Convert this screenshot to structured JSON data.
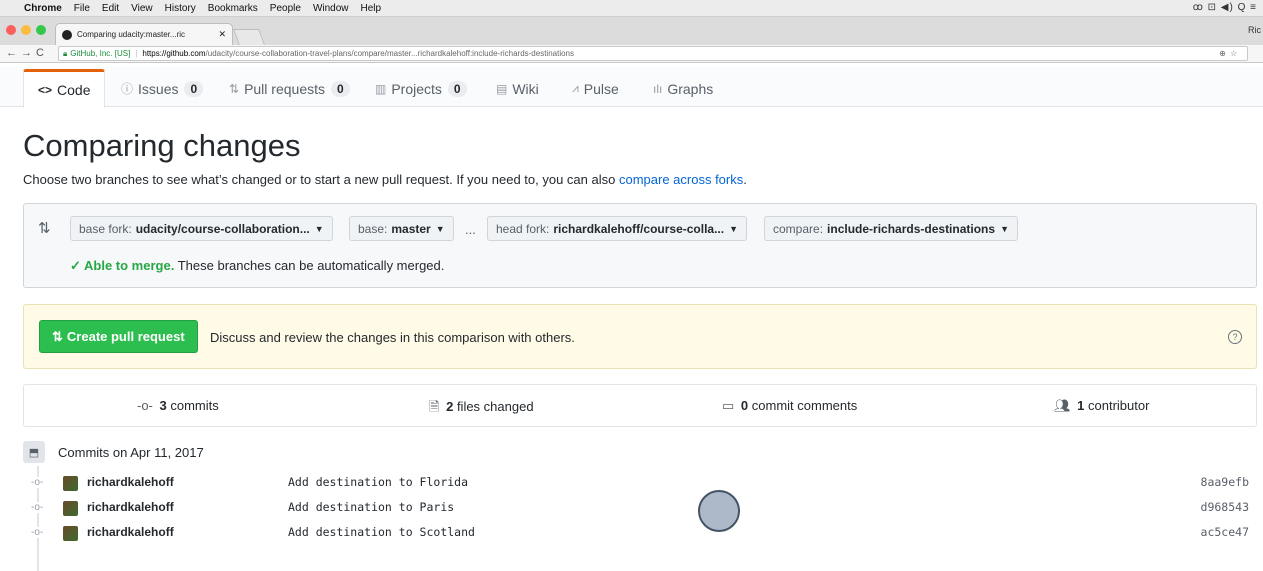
{
  "macbar": {
    "app": "Chrome",
    "menus": [
      "File",
      "Edit",
      "View",
      "History",
      "Bookmarks",
      "People",
      "Window",
      "Help"
    ],
    "status": "ꝏ ⊡ ◀) Q ≡"
  },
  "browser": {
    "tab_title": "Comparing udacity:master...ric",
    "profile": "Ric",
    "security_label": "GitHub, Inc. [US]",
    "url_host": "https://github.com",
    "url_path": "/udacity/course-collaboration-travel-plans/compare/master...richardkalehoff:include-richards-destinations"
  },
  "repo_tabs": [
    {
      "label": "Code",
      "icon": "<>",
      "count": ""
    },
    {
      "label": "Issues",
      "icon": "ⓘ",
      "count": "0"
    },
    {
      "label": "Pull requests",
      "icon": "⇅",
      "count": "0"
    },
    {
      "label": "Projects",
      "icon": "▥",
      "count": "0"
    },
    {
      "label": "Wiki",
      "icon": "▤",
      "count": ""
    },
    {
      "label": "Pulse",
      "icon": "⩘",
      "count": ""
    },
    {
      "label": "Graphs",
      "icon": "ılı",
      "count": ""
    }
  ],
  "page": {
    "title": "Comparing changes",
    "subtitle": "Choose two branches to see what’s changed or to start a new pull request. If you need to, you can also",
    "subtitle_link": "compare across forks",
    "subtitle_end": "."
  },
  "range": {
    "base_fork_label": "base fork:",
    "base_fork_value": "udacity/course-collaboration...",
    "base_label": "base:",
    "base_value": "master",
    "ellipsis": "...",
    "head_fork_label": "head fork:",
    "head_fork_value": "richardkalehoff/course-colla...",
    "compare_label": "compare:",
    "compare_value": "include-richards-destinations",
    "merge_status": "✓ Able to merge.",
    "merge_text": "These branches can be automatically merged."
  },
  "flash": {
    "button_label": "Create pull request",
    "text": "Discuss and review the changes in this comparison with others."
  },
  "summary": {
    "commits_count": "3",
    "commits_label": "commits",
    "files_count": "2",
    "files_label": "files changed",
    "comments_count": "0",
    "comments_label": "commit comments",
    "contributors_count": "1",
    "contributors_label": "contributor"
  },
  "commits": {
    "date_heading": "Commits on Apr 11, 2017",
    "rows": [
      {
        "author": "richardkalehoff",
        "message": "Add destination to Florida",
        "sha": "8aa9efb"
      },
      {
        "author": "richardkalehoff",
        "message": "Add destination to Paris",
        "sha": "d968543"
      },
      {
        "author": "richardkalehoff",
        "message": "Add destination to Scotland",
        "sha": "ac5ce47"
      }
    ]
  },
  "colors": {
    "accent_orange": "#e36209",
    "create_green": "#2cbe4e",
    "link_blue": "#0366d6",
    "merge_green": "#28a745"
  }
}
